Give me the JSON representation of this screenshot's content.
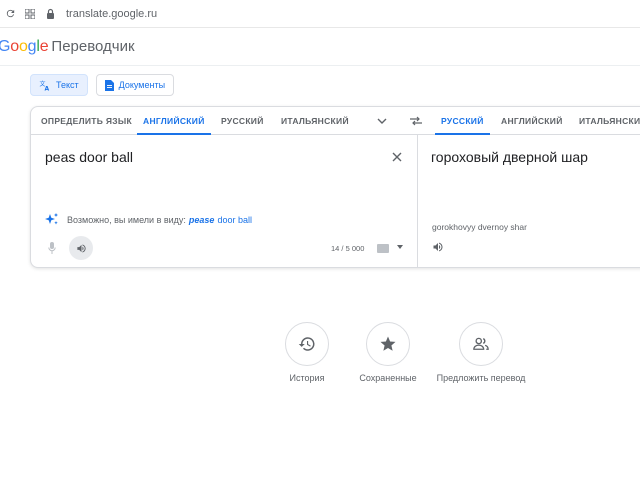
{
  "browser": {
    "url": "translate.google.ru"
  },
  "header": {
    "logo_letters": [
      {
        "ch": "G",
        "color": "#4285F4"
      },
      {
        "ch": "o",
        "color": "#EA4335"
      },
      {
        "ch": "o",
        "color": "#FBBC05"
      },
      {
        "ch": "g",
        "color": "#4285F4"
      },
      {
        "ch": "l",
        "color": "#34A853"
      },
      {
        "ch": "e",
        "color": "#EA4335"
      }
    ],
    "title": "Переводчик"
  },
  "modes": {
    "text_label": "Текст",
    "documents_label": "Документы"
  },
  "source": {
    "tabs": [
      "ОПРЕДЕЛИТЬ ЯЗЫК",
      "АНГЛИЙСКИЙ",
      "РУССКИЙ",
      "ИТАЛЬЯНСКИЙ"
    ],
    "active_tab": "АНГЛИЙСКИЙ",
    "text": "peas door ball",
    "suggestion_prefix": "Возможно, вы имели в виду:",
    "suggestion_highlight": "pease",
    "suggestion_rest": "door ball",
    "counter": "14 / 5 000"
  },
  "target": {
    "tabs": [
      "РУССКИЙ",
      "АНГЛИЙСКИЙ",
      "ИТАЛЬЯНСКИЙ"
    ],
    "active_tab": "РУССКИЙ",
    "text": "гороховый дверной шар",
    "transliteration": "gorokhovyy dvernoy shar"
  },
  "actions": {
    "history": "История",
    "saved": "Сохраненные",
    "suggest": "Предложить перевод"
  },
  "colors": {
    "accent": "#1a73e8",
    "text_secondary": "#5f6368"
  }
}
